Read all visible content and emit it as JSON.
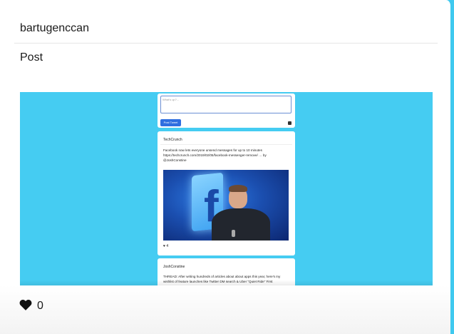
{
  "card": {
    "username": "bartugenccan",
    "section_title": "Post",
    "likes": "0"
  },
  "screenshot": {
    "compose_placeholder": "What's up?...",
    "tweet_button": "Post Tweet",
    "tweets": [
      {
        "user": "TechCrunch",
        "text": "Facebook now lets everyone unsend messages for up to 10 minutes https://techcrunch.com/2019/02/05/facebook-messenger-remove/ … by @JoshConstine",
        "likes": "4"
      },
      {
        "user": "JoshConstine",
        "text": "THREAD: After writing hundreds of articles about about apps this year, here's my wishlist of feature launches like Twitter DM search & Uber \"Quiet Ride\" First"
      }
    ]
  },
  "colors": {
    "accent": "#45ccf2",
    "button": "#2f6ee0"
  }
}
